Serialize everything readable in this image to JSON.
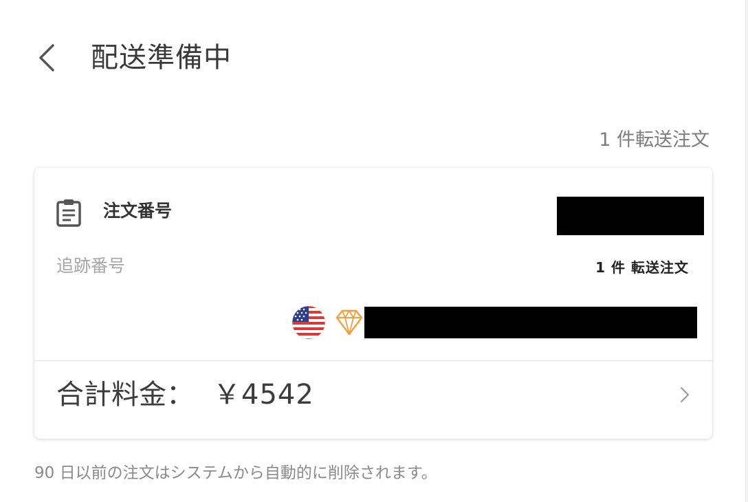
{
  "header": {
    "title": "配送準備中",
    "back_icon": "chevron-left-icon"
  },
  "summary": {
    "forward_count": "1 件転送注文"
  },
  "order_card": {
    "order_label": "注文番号",
    "order_icon": "clipboard-icon",
    "tracking_label": "追跡番号",
    "tracking_count": "1 件 転送注文",
    "flag_icon": "us-flag-icon",
    "gem_icon": "diamond-icon",
    "total_label": "合計料金：",
    "total_value": "￥4542",
    "chevron_icon": "chevron-right-icon"
  },
  "footer": {
    "note": "90 日以前の注文はシステムから自動的に削除されます。"
  },
  "colors": {
    "background": "#ffffff",
    "text_primary": "#333333",
    "text_muted": "#a6a6a6",
    "gem_orange": "#f0a040",
    "flag_red": "#d83a3a",
    "flag_blue": "#2c3f8c"
  }
}
